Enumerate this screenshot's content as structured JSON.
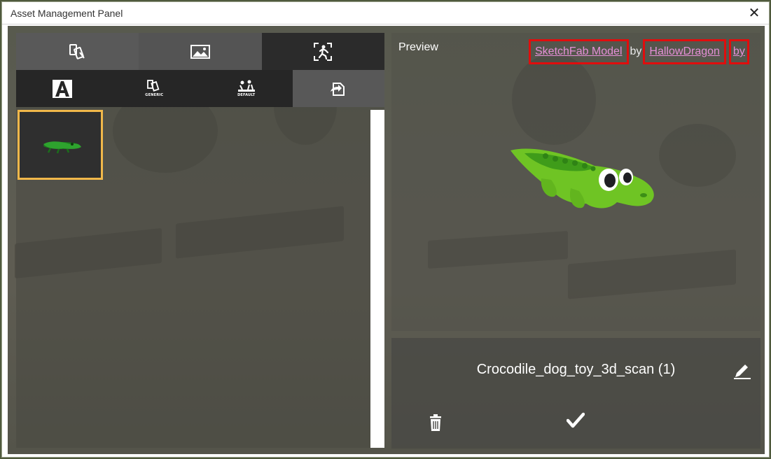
{
  "window": {
    "title": "Asset Management Panel",
    "close_glyph": "✕"
  },
  "tabs_top": [
    {
      "icon": "generic-assets-icon",
      "active": false
    },
    {
      "icon": "image-icon",
      "active": true
    },
    {
      "icon": "person-frame-icon",
      "active": false
    }
  ],
  "tabs_sub": [
    {
      "icon": "letter-a-icon",
      "label": "",
      "active": false
    },
    {
      "icon": "generic-icon",
      "label": "GENERIC",
      "active": false
    },
    {
      "icon": "default-icon",
      "label": "DEFAULT",
      "active": false
    },
    {
      "icon": "import-icon",
      "label": "",
      "active": true
    }
  ],
  "assets": [
    {
      "name": "Crocodile_dog_toy_3d_scan (1)",
      "selected": true
    }
  ],
  "preview": {
    "label": "Preview",
    "attribution": {
      "model_link": "SketchFab Model",
      "by1": "by",
      "author_link": "HallowDragon",
      "by2": "by"
    }
  },
  "info": {
    "asset_name": "Crocodile_dog_toy_3d_scan (1)"
  },
  "colors": {
    "selection_border": "#f1b84a",
    "link": "#e48fd6",
    "highlight_box": "#e00d0d",
    "croc_green": "#7ccc2c"
  }
}
